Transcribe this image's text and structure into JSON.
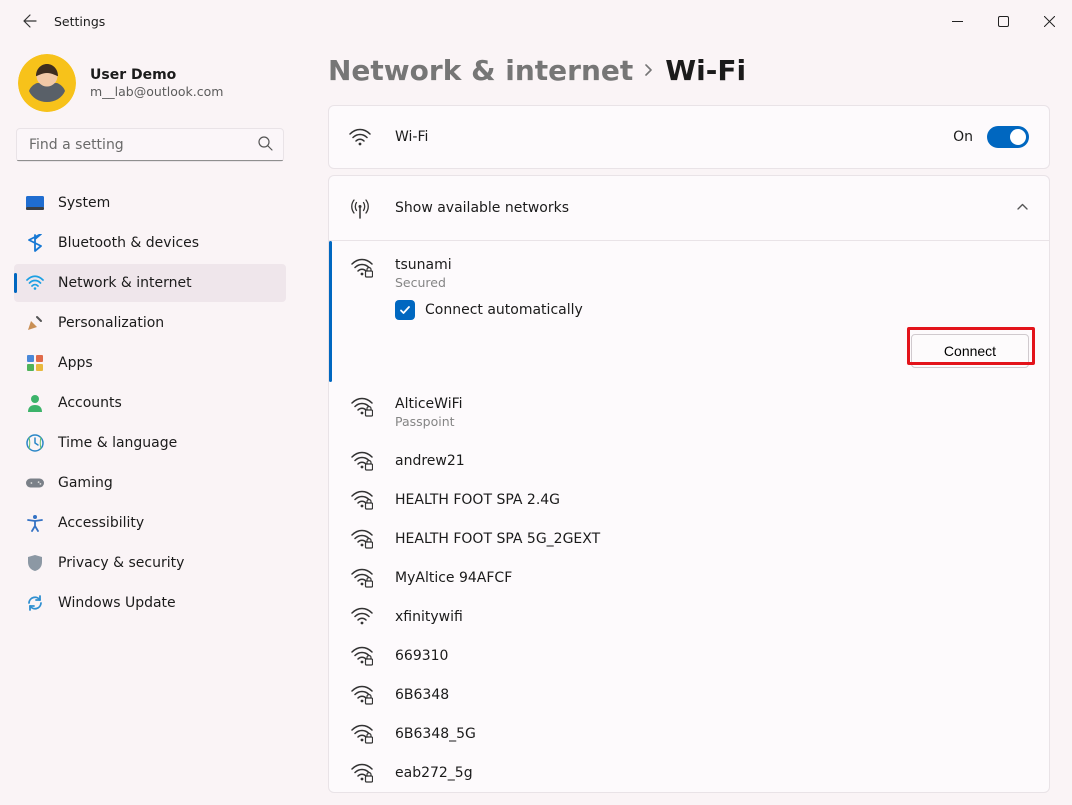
{
  "window": {
    "title": "Settings"
  },
  "user": {
    "name": "User Demo",
    "email": "m__lab@outlook.com"
  },
  "search": {
    "placeholder": "Find a setting"
  },
  "sidebar": {
    "items": [
      {
        "label": "System",
        "icon": "system"
      },
      {
        "label": "Bluetooth & devices",
        "icon": "bluetooth"
      },
      {
        "label": "Network & internet",
        "icon": "network",
        "selected": true
      },
      {
        "label": "Personalization",
        "icon": "personalization"
      },
      {
        "label": "Apps",
        "icon": "apps"
      },
      {
        "label": "Accounts",
        "icon": "accounts"
      },
      {
        "label": "Time & language",
        "icon": "time"
      },
      {
        "label": "Gaming",
        "icon": "gaming"
      },
      {
        "label": "Accessibility",
        "icon": "accessibility"
      },
      {
        "label": "Privacy & security",
        "icon": "privacy"
      },
      {
        "label": "Windows Update",
        "icon": "update"
      }
    ]
  },
  "breadcrumb": {
    "parent": "Network & internet",
    "current": "Wi-Fi"
  },
  "wifi": {
    "label": "Wi-Fi",
    "state": "On"
  },
  "availableLabel": "Show available networks",
  "selectedNetwork": {
    "name": "tsunami",
    "status": "Secured",
    "autoLabel": "Connect automatically",
    "autoChecked": true,
    "connectLabel": "Connect"
  },
  "networks": [
    {
      "name": "AlticeWiFi",
      "sub": "Passpoint",
      "lock": true
    },
    {
      "name": "andrew21",
      "lock": true
    },
    {
      "name": "HEALTH FOOT SPA 2.4G",
      "lock": true
    },
    {
      "name": "HEALTH FOOT SPA 5G_2GEXT",
      "lock": true
    },
    {
      "name": "MyAltice 94AFCF",
      "lock": true
    },
    {
      "name": "xfinitywifi",
      "lock": false
    },
    {
      "name": "669310",
      "lock": true
    },
    {
      "name": "6B6348",
      "lock": true
    },
    {
      "name": "6B6348_5G",
      "lock": true
    },
    {
      "name": "eab272_5g",
      "lock": true
    }
  ]
}
